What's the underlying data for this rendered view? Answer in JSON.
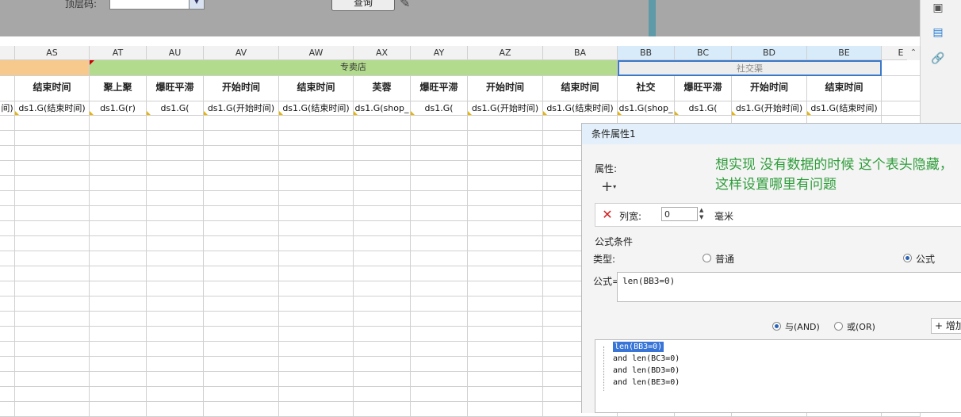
{
  "toolbar": {
    "param_label": "顶层码:",
    "combo_value": "",
    "query_label": "查询"
  },
  "grid": {
    "columns": [
      {
        "id": "c0",
        "label": ""
      },
      {
        "id": "AS",
        "label": "AS"
      },
      {
        "id": "AT",
        "label": "AT"
      },
      {
        "id": "AU",
        "label": "AU"
      },
      {
        "id": "AV",
        "label": "AV"
      },
      {
        "id": "AW",
        "label": "AW"
      },
      {
        "id": "AX",
        "label": "AX"
      },
      {
        "id": "AY",
        "label": "AY"
      },
      {
        "id": "AZ",
        "label": "AZ"
      },
      {
        "id": "BA",
        "label": "BA"
      },
      {
        "id": "BB",
        "label": "BB"
      },
      {
        "id": "BC",
        "label": "BC"
      },
      {
        "id": "BD",
        "label": "BD"
      },
      {
        "id": "BE",
        "label": "BE"
      },
      {
        "id": "BF",
        "label": "E"
      }
    ],
    "band_store": "专卖店",
    "band_social": "社交渠",
    "headers": [
      "",
      "结束时间",
      "聚上聚",
      "爆旺平滞",
      "开始时间",
      "结束时间",
      "芙蓉",
      "爆旺平滞",
      "开始时间",
      "结束时间",
      "社交",
      "爆旺平滞",
      "开始时间",
      "结束时间",
      ""
    ],
    "row3": [
      "间)",
      "ds1.G(结束时间)",
      "ds1.G(r)",
      "ds1.G(",
      "ds1.G(开始时间)",
      "ds1.G(结束时间)",
      "ds1.G(shop_",
      "ds1.G(",
      "ds1.G(开始时间)",
      "ds1.G(结束时间)",
      "ds1.G(shop_",
      "ds1.G(",
      "ds1.G(开始时间)",
      "ds1.G(结束时间)",
      ""
    ]
  },
  "dialog": {
    "title": "条件属性1",
    "attributes_label": "属性:",
    "annotation": "想实现 没有数据的时候 这个表头隐藏，这样设置哪里有问题",
    "add_symbol": "+",
    "col_width_label": "列宽:",
    "col_width_value": "0",
    "unit": "毫米",
    "formula_section": "公式条件",
    "type_label": "类型:",
    "type_normal": "普通",
    "type_formula": "公式",
    "formula_label": "公式=",
    "formula_value": "len(BB3=0)",
    "and_label": "与(AND)",
    "or_label": "或(OR)",
    "add_button": "增加",
    "conditions": [
      "len(BB3=0)",
      "and len(BC3=0)",
      "and len(BD3=0)",
      "and len(BE3=0)"
    ]
  },
  "colors": {
    "accent": "#3875d7",
    "annotation": "#2e9d3a",
    "band_orange": "#f7c98d",
    "band_green": "#b2db8e"
  }
}
